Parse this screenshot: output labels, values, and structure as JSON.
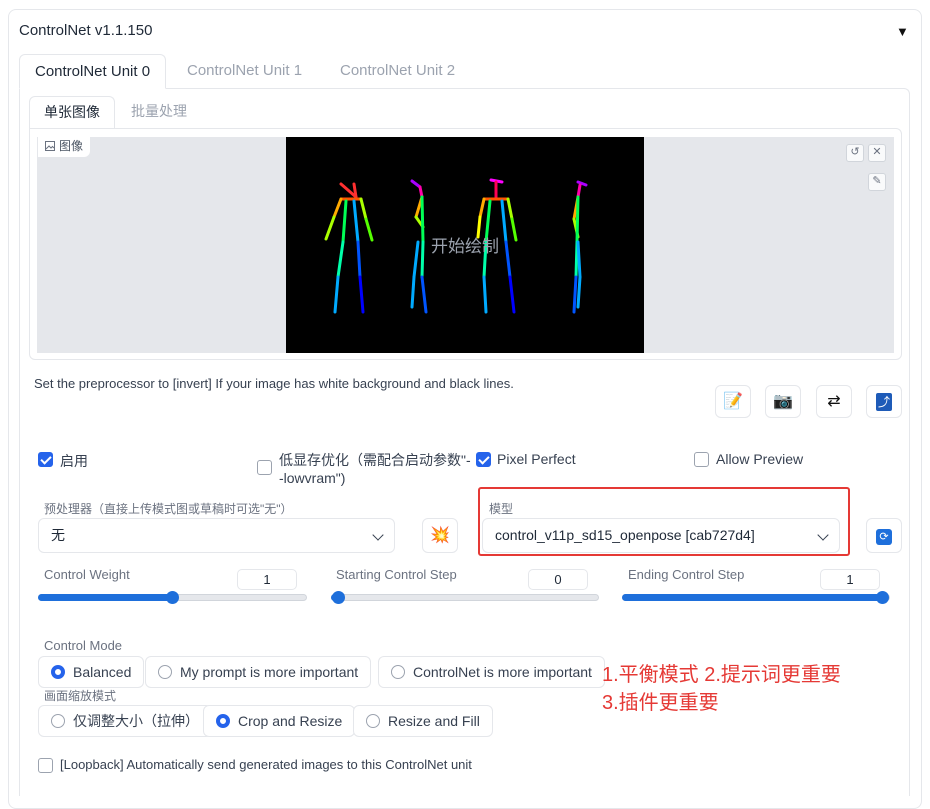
{
  "panel": {
    "title": "ControlNet v1.1.150",
    "collapse_glyph": "▼"
  },
  "tabs": [
    "ControlNet Unit 0",
    "ControlNet Unit 1",
    "ControlNet Unit 2"
  ],
  "subtabs": [
    "单张图像",
    "批量处理"
  ],
  "image": {
    "label": "图像",
    "label_icon": "image-icon",
    "canvas_text": "开始绘制"
  },
  "hint": "Set the preprocessor to [invert] If your image has white background and black lines.",
  "tool_buttons": [
    "edit-icon",
    "camera-icon",
    "swap-icon",
    "send-icon"
  ],
  "checkboxes": {
    "enable": {
      "label": "启用",
      "checked": true
    },
    "lowvram": {
      "label": "低显存优化（需配合启动参数\"--lowvram\")",
      "line1": "低显存优化（需配合启动参数\"-",
      "line2": "-lowvram\")",
      "checked": false
    },
    "pixel_perfect": {
      "label": "Pixel Perfect",
      "checked": true
    },
    "allow_preview": {
      "label": "Allow Preview",
      "checked": false
    },
    "loopback": {
      "label": "[Loopback] Automatically send generated images to this ControlNet unit",
      "checked": false
    }
  },
  "preprocessor": {
    "label": "预处理器（直接上传模式图或草稿时可选\"无\"）",
    "value": "无"
  },
  "model": {
    "label": "模型",
    "value": "control_v11p_sd15_openpose [cab727d4]"
  },
  "sliders": {
    "weight": {
      "label": "Control Weight",
      "value": "1",
      "fraction": 0.5
    },
    "start": {
      "label": "Starting Control Step",
      "value": "0",
      "fraction": 0.0
    },
    "end": {
      "label": "Ending Control Step",
      "value": "1",
      "fraction": 1.0
    }
  },
  "control_mode": {
    "label": "Control Mode",
    "options": [
      "Balanced",
      "My prompt is more important",
      "ControlNet is more important"
    ],
    "selected": "Balanced"
  },
  "resize_mode": {
    "label": "画面缩放模式",
    "options": [
      "仅调整大小（拉伸）",
      "Crop and Resize",
      "Resize and Fill"
    ],
    "selected": "Crop and Resize"
  },
  "annotation": {
    "line1": "1.平衡模式 2.提示词更重要",
    "line2": "3.插件更重要"
  },
  "colors": {
    "accent": "#2563eb",
    "annotation": "#e53935"
  }
}
